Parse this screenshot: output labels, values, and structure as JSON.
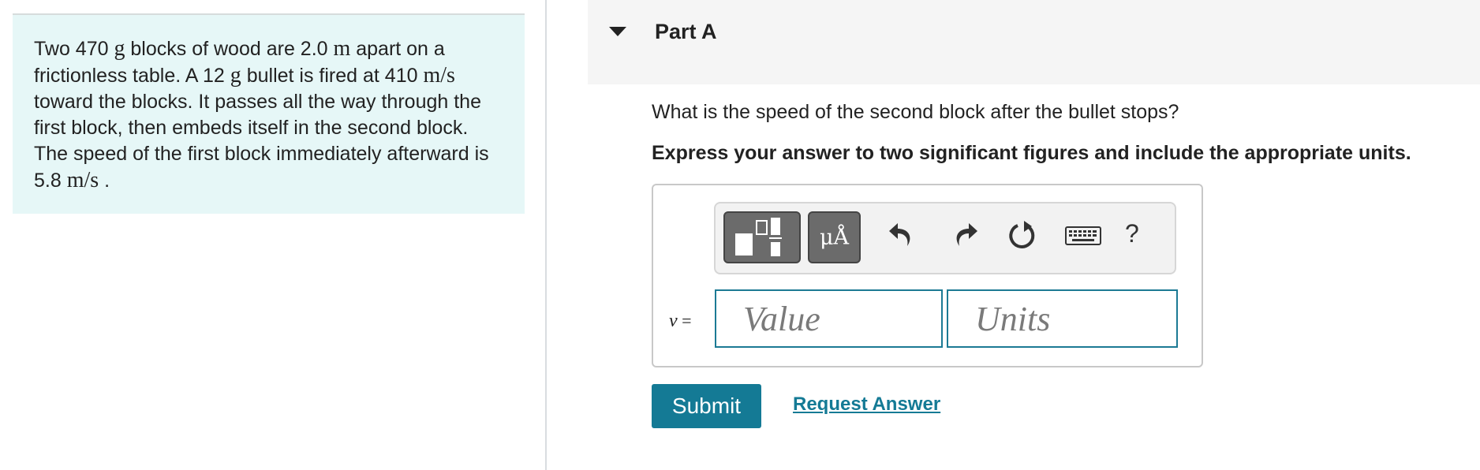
{
  "problem": {
    "t1": "Two 470 ",
    "u1": "g",
    "t2": " blocks of wood are 2.0 ",
    "u2": "m",
    "t3": " apart on a frictionless table. A 12 ",
    "u3": "g",
    "t4": " bullet is fired at 410 ",
    "u4": "m/s",
    "t5": " toward the blocks. It passes all the way through the first block, then embeds itself in the second block. The speed of the first block immediately afterward is 5.8 ",
    "u5": "m/s",
    "t6": " ."
  },
  "part": {
    "title": "Part A"
  },
  "question": "What is the speed of the second block after the bullet stops?",
  "instruction": "Express your answer to two significant figures and include the appropriate units.",
  "toolbar": {
    "symbols_label": "μÅ",
    "help_label": "?",
    "icons": [
      "templates-icon",
      "symbols-icon",
      "undo-icon",
      "redo-icon",
      "reset-icon",
      "keyboard-icon",
      "help-icon"
    ]
  },
  "answer": {
    "variable": "v",
    "equals": "=",
    "value_placeholder": "Value",
    "units_placeholder": "Units"
  },
  "actions": {
    "submit_label": "Submit",
    "request_label": "Request Answer"
  },
  "colors": {
    "accent": "#147a95",
    "problem_bg": "#e6f7f7",
    "header_bg": "#f5f5f5",
    "toolbar_button": "#6b6b6b"
  }
}
